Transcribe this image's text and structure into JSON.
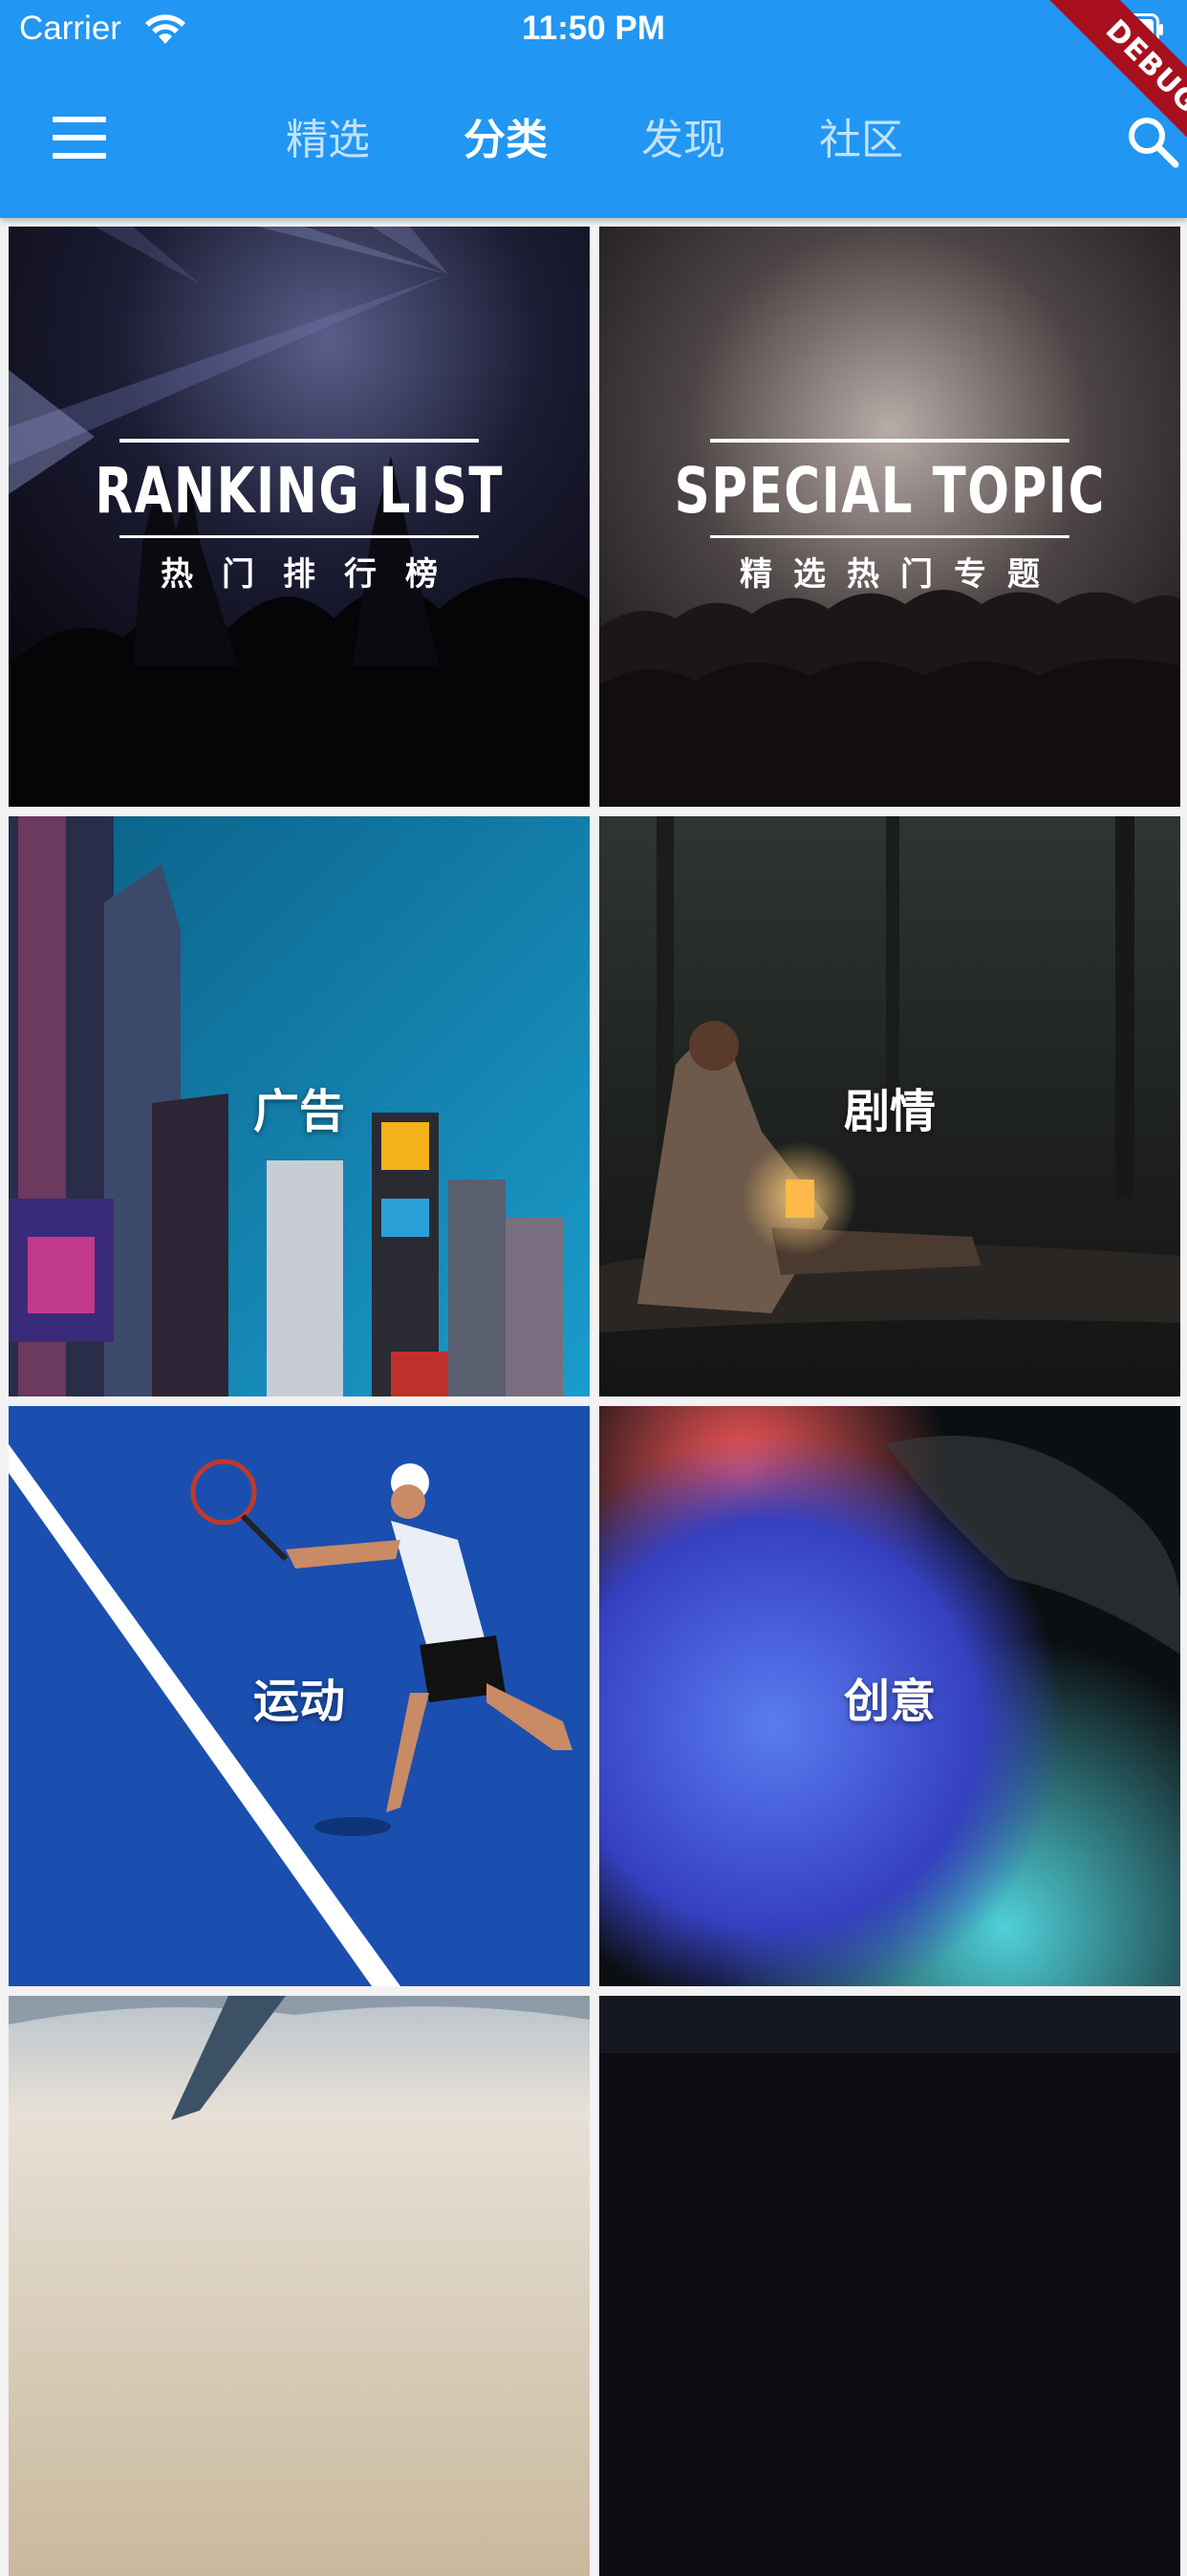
{
  "status_bar": {
    "carrier": "Carrier",
    "time": "11:50 PM"
  },
  "app_bar": {
    "color": "#2196f3",
    "tabs": [
      {
        "label": "精选",
        "active": false
      },
      {
        "label": "分类",
        "active": true
      },
      {
        "label": "发现",
        "active": false
      },
      {
        "label": "社区",
        "active": false
      }
    ],
    "debug_banner": "DEBUG"
  },
  "categories": [
    {
      "type": "logo",
      "title": "RANKING LIST",
      "subtitle": "热门排行榜",
      "icon": "concert-photo"
    },
    {
      "type": "logo",
      "title": "SPECIAL TOPIC",
      "subtitle": "精选热门专题",
      "icon": "crowd-photo"
    },
    {
      "type": "label",
      "label": "广告",
      "icon": "city-buildings-photo"
    },
    {
      "type": "label",
      "label": "剧情",
      "icon": "lantern-woman-photo"
    },
    {
      "type": "label",
      "label": "运动",
      "icon": "tennis-player-photo"
    },
    {
      "type": "label",
      "label": "创意",
      "icon": "color-smoke-photo"
    },
    {
      "type": "image",
      "icon": "airplane-wing-photo"
    },
    {
      "type": "image",
      "icon": "dark-photo"
    }
  ]
}
